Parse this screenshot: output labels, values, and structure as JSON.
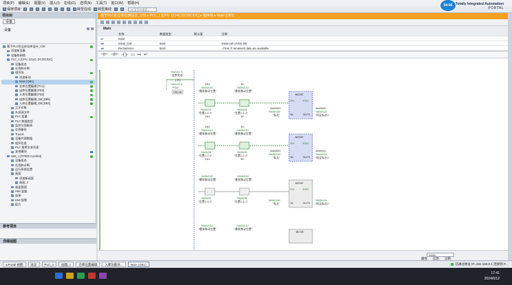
{
  "menu": [
    "项目(P)",
    "编辑(E)",
    "视图(V)",
    "插入(I)",
    "在线(O)",
    "选项(N)",
    "工具(T)",
    "窗口(W)",
    "帮助(H)"
  ],
  "toolbar": {
    "save_label": "保存项目",
    "go_online": "转至在线",
    "go_offline": "转至离线",
    "search_placeholder": "<在项目中搜索>"
  },
  "brand": {
    "line1": "Totally Integrated Automation",
    "line2": "PORTAL",
    "clock": "04:06"
  },
  "breadcrumb": "基于PLC的立体仓库设计_V16 ▸ PLC_1 [CPU 1214C DC/DC/DC] ▸ 程序块 ▸ Main [OB1]",
  "left": {
    "panel_title": "项目树",
    "device_tab": "设备",
    "tree_header": "设备",
    "tree": [
      {
        "label": "基于PLC的立体仓库设计_V16",
        "indent": 0,
        "status": "ok"
      },
      {
        "label": "添加新设备",
        "indent": 1
      },
      {
        "label": "设备和网络",
        "indent": 1
      },
      {
        "label": "PLC_1 [CPU 1214C DC/DC/DC]",
        "indent": 1,
        "status": "ok",
        "selected": true
      },
      {
        "label": "设备组态",
        "indent": 2
      },
      {
        "label": "在线和诊断",
        "indent": 2
      },
      {
        "label": "程序块",
        "indent": 2,
        "status": "ok"
      },
      {
        "label": "添加新块",
        "indent": 3
      },
      {
        "label": "Main [OB1]",
        "indent": 3,
        "status": "ok",
        "selected": true
      },
      {
        "label": "仓库位置编辑 [FC1]",
        "indent": 3,
        "status": "ok"
      },
      {
        "label": "出库位置编辑 [FB3]",
        "indent": 3,
        "status": "ok"
      },
      {
        "label": "入库位置编辑 [FB2]",
        "indent": 3,
        "status": "ok"
      },
      {
        "label": "出库位置编辑_DB [DB5]",
        "indent": 3,
        "status": "ok"
      },
      {
        "label": "入库位置编辑_DB [DB3]",
        "indent": 3,
        "status": "ok"
      },
      {
        "label": "工艺对象",
        "indent": 2
      },
      {
        "label": "外部源文件",
        "indent": 2
      },
      {
        "label": "PLC 变量",
        "indent": 2,
        "status": "ok"
      },
      {
        "label": "PLC 数据类型",
        "indent": 2
      },
      {
        "label": "监控与强制表",
        "indent": 2
      },
      {
        "label": "在线备份",
        "indent": 2
      },
      {
        "label": "Traces",
        "indent": 2
      },
      {
        "label": "设备代理数据",
        "indent": 2
      },
      {
        "label": "程序信息",
        "indent": 2
      },
      {
        "label": "PLC 报警文本列表",
        "indent": 2
      },
      {
        "label": "本地模块",
        "indent": 2,
        "status": "box"
      },
      {
        "label": "HMI_1 [TP900 Comfort]",
        "indent": 1,
        "status": "ok"
      },
      {
        "label": "设备组态",
        "indent": 2
      },
      {
        "label": "在线和诊断",
        "indent": 2
      },
      {
        "label": "运行系统设置",
        "indent": 2
      },
      {
        "label": "画面",
        "indent": 2
      },
      {
        "label": "添加新画面",
        "indent": 3
      },
      {
        "label": "画面_1",
        "indent": 3
      },
      {
        "label": "画面管理",
        "indent": 2
      },
      {
        "label": "HMI 变量",
        "indent": 2
      },
      {
        "label": "连接",
        "indent": 2
      },
      {
        "label": "HMI 报警",
        "indent": 2
      },
      {
        "label": "配方",
        "indent": 2
      }
    ],
    "reference_section": "参考项目",
    "details_section": "详细视图"
  },
  "editor": {
    "block_name": "Main",
    "iface_headers": [
      "",
      "名称",
      "数据类型",
      "默认值",
      "注释"
    ],
    "iface_rows": [
      {
        "name": "Input",
        "type": "",
        "default": "",
        "comment": ""
      },
      {
        "name": "Initial_Call",
        "type": "Bool",
        "default": "",
        "comment": "Initial call of this OB"
      },
      {
        "name": "Remanence",
        "type": "Bool",
        "default": "",
        "comment": "=True, if remanent data are available"
      }
    ],
    "zoom": "100%",
    "foot_tabs": [
      "属性",
      "信息",
      "诊断"
    ]
  },
  "ladder": {
    "top_contact": {
      "addr": "%M102.3",
      "name": "\"出库完成\"",
      "addr2": "%M102.3",
      "name2": "\"P1D\"",
      "state": "FALSE"
    },
    "networks": [
      {
        "cmp1_top": "240",
        "cmp1_addr": "%MW100",
        "cmp1_name": "\"横排移动位置\"",
        "cmp1_addr2": "%MW26",
        "cmp1_name2": "\"位置2-2-4\"",
        "cmp1_val": "240",
        "cmp2_top": "90",
        "cmp2_addr": "%MW102",
        "cmp2_name": "\"横排移动位置\"",
        "cmp2_addr2": "%MW28",
        "cmp2_name2": "\"位置2-2-2\"",
        "cmp2_val": "90",
        "move_label": "MOVE",
        "in_val": "16#0000",
        "in_addr": "%MW160",
        "in_name": "\"标志\"",
        "out_val": "16#0000",
        "out_addr": "%MW122",
        "out_name": "\"间运标志1\""
      },
      {
        "cmp1_top": "240",
        "cmp1_addr": "%MW100",
        "cmp1_name": "\"横排移动位置\"",
        "cmp1_addr2": "%MW28",
        "cmp1_name2": "\"位置2-2-4\"",
        "cmp1_val": "240",
        "cmp2_top": "90",
        "cmp2_addr": "%MW102",
        "cmp2_name": "\"横排移动位置\"",
        "cmp2_addr2": "%MW30",
        "cmp2_name2": "\"位置2-2-2\"",
        "cmp2_val": "90",
        "move_label": "MOVE",
        "in_val": "16#0000",
        "in_addr": "%MW160",
        "in_name": "\"标志\"",
        "out_val": "16#0000",
        "out_addr": "%MW124",
        "out_name": "\"间运标志1\""
      },
      {
        "cmp1_top": "",
        "cmp1_addr": "%MW100",
        "cmp1_name": "\"横排移动位置\"",
        "cmp1_addr2": "%MW32",
        "cmp1_name2": "\"位置2-4-4\"",
        "cmp1_val": "",
        "cmp2_top": "",
        "cmp2_addr": "%MW102",
        "cmp2_name": "\"横排移动位置\"",
        "cmp2_addr2": "%MW38",
        "cmp2_name2": "\"位置2-4-2\"",
        "cmp2_val": "",
        "move_label": "MOVE",
        "in_val": "",
        "in_addr": "%MW160",
        "in_name": "\"标志\"",
        "out_val": "",
        "out_addr": "%MW126",
        "out_name": "\"间运标志1\""
      }
    ],
    "bottom": {
      "addr1": "%MW100",
      "name1": "\"横排移动位置\"",
      "addr2": "%MW102",
      "name2": "\"横排移动位置\"",
      "move_label": "MOVE"
    }
  },
  "portal": {
    "portal_label": "◂ Portal 视图",
    "tabs": [
      "总览",
      "PLC_1",
      "画面_1",
      "仓库位置编辑",
      "入库功能块...",
      "Main (OB1)"
    ],
    "active_tab": 5,
    "status": "已通过地址 IP=192.168.0.1 连接到 P..."
  },
  "taskbar": {
    "time": "17:41",
    "date": "2024/6/12"
  }
}
